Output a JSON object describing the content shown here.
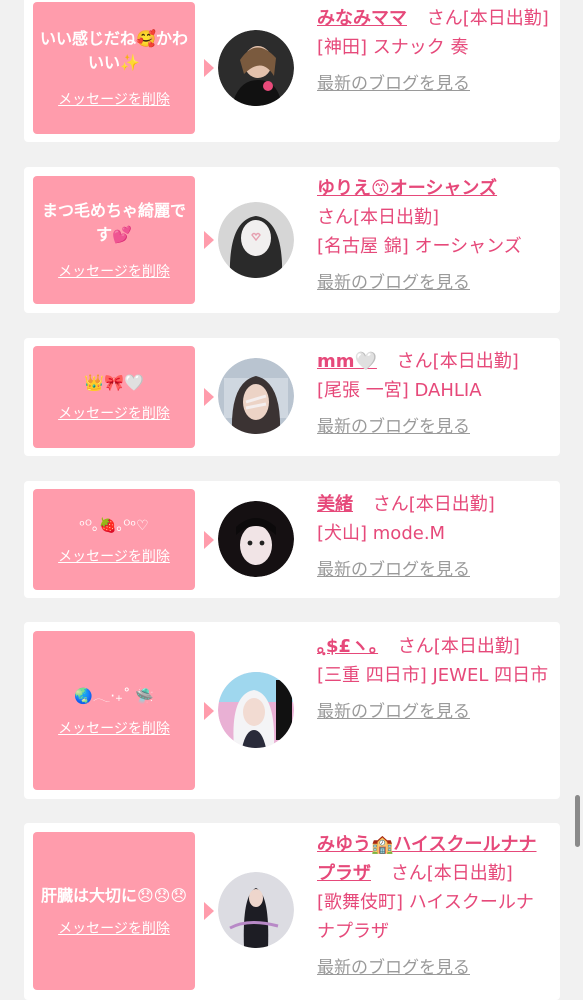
{
  "delete_label": "メッセージを削除",
  "blog_label": "最新のブログを見る",
  "suffix": "さん[本日出勤]",
  "cards": [
    {
      "message": "いい感じだね🥰かわいい✨",
      "name": "みなみママ",
      "location": "[神田] スナック 奏",
      "avatar_color": "#3a3a3a"
    },
    {
      "message": "まつ毛めちゃ綺麗です💕",
      "name": "ゆりえ😙オーシャンズ",
      "location": "[名古屋 錦] オーシャンズ",
      "avatar_color": "#6b6b6b"
    },
    {
      "message": "👑🎀🤍",
      "name": "mm🤍",
      "location": "[尾張 一宮] DAHLIA",
      "avatar_color": "#b7c2cf"
    },
    {
      "message": "ᵒᴼ｡🍓｡ᴼᵒ♡",
      "name": "美緒",
      "location": "[犬山] mode.M",
      "avatar_color": "#1c1416"
    },
    {
      "message": "🌏𓂃‧₊˚ 🛸",
      "name": "｡ฺ$£ヽ｡",
      "location": "[三重 四日市] JEWEL 四日市",
      "avatar_color": "#e9a9cf"
    },
    {
      "message": "肝臓は大切に😞😞😞",
      "name": "みゆう🏫ハイスクールナナプラザ",
      "location": "[歌舞伎町] ハイスクールナナプラザ",
      "avatar_color": "#d9d9de"
    }
  ]
}
